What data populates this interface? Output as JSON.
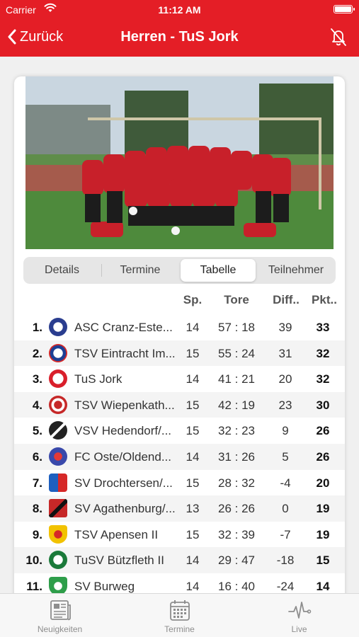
{
  "status_bar": {
    "carrier": "Carrier",
    "time": "11:12 AM"
  },
  "nav": {
    "back_label": "Zurück",
    "title": "Herren - TuS Jork"
  },
  "segments": [
    "Details",
    "Termine",
    "Tabelle",
    "Teilnehmer"
  ],
  "active_segment": "Tabelle",
  "table": {
    "headers": {
      "sp": "Sp.",
      "tore": "Tore",
      "diff": "Diff..",
      "pkt": "Pkt.."
    },
    "rows": [
      {
        "rank": "1.",
        "team": "ASC Cranz-Este...",
        "sp": "14",
        "tore": "57 : 18",
        "diff": "39",
        "pkt": "33",
        "logo_color": "#2a3d8f"
      },
      {
        "rank": "2.",
        "team": "TSV Eintracht Im...",
        "sp": "15",
        "tore": "55 : 24",
        "diff": "31",
        "pkt": "32",
        "logo_color": "#1c3f94"
      },
      {
        "rank": "3.",
        "team": "TuS Jork",
        "sp": "14",
        "tore": "41 : 21",
        "diff": "20",
        "pkt": "32",
        "logo_color": "#d91f2b"
      },
      {
        "rank": "4.",
        "team": "TSV Wiepenkath...",
        "sp": "15",
        "tore": "42 : 19",
        "diff": "23",
        "pkt": "30",
        "logo_color": "#c62828"
      },
      {
        "rank": "5.",
        "team": "VSV Hedendorf/...",
        "sp": "15",
        "tore": "32 : 23",
        "diff": "9",
        "pkt": "26",
        "logo_color": "#222222"
      },
      {
        "rank": "6.",
        "team": "FC Oste/Oldend...",
        "sp": "14",
        "tore": "31 : 26",
        "diff": "5",
        "pkt": "26",
        "logo_color": "#3949ab"
      },
      {
        "rank": "7.",
        "team": "SV Drochtersen/...",
        "sp": "15",
        "tore": "28 : 32",
        "diff": "-4",
        "pkt": "20",
        "logo_color": "#1e5fbf"
      },
      {
        "rank": "8.",
        "team": "SV Agathenburg/...",
        "sp": "13",
        "tore": "26 : 26",
        "diff": "0",
        "pkt": "19",
        "logo_color": "#c62828"
      },
      {
        "rank": "9.",
        "team": "TSV Apensen II",
        "sp": "15",
        "tore": "32 : 39",
        "diff": "-7",
        "pkt": "19",
        "logo_color": "#f2c200"
      },
      {
        "rank": "10.",
        "team": "TuSV Bützfleth II",
        "sp": "14",
        "tore": "29 : 47",
        "diff": "-18",
        "pkt": "15",
        "logo_color": "#1b7a3a"
      },
      {
        "rank": "11.",
        "team": "SV Burweg",
        "sp": "14",
        "tore": "16 : 40",
        "diff": "-24",
        "pkt": "14",
        "logo_color": "#2e9e4a"
      }
    ]
  },
  "tabbar": {
    "items": [
      "Neuigkeiten",
      "Termine",
      "Live"
    ]
  },
  "colors": {
    "brand": "#e41e26",
    "tab_icon": "#8e8e8e"
  }
}
